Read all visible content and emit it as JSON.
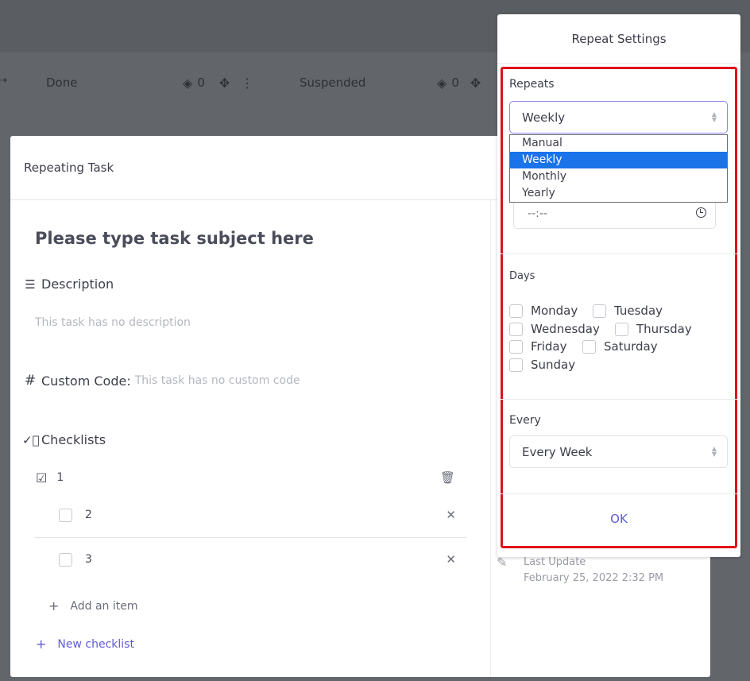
{
  "board": {
    "columns": [
      {
        "title": "Done",
        "count": "0"
      },
      {
        "title": "Suspended",
        "count": "0"
      }
    ]
  },
  "task_modal": {
    "header": "Repeating Task",
    "subject_placeholder": "Please type task subject here",
    "description_label": "Description",
    "description_empty": "This task has no description",
    "custom_code_label": "Custom Code:",
    "custom_code_empty": "This task has no custom code",
    "checklists_label": "Checklists",
    "checklist": {
      "title": "1",
      "items": [
        {
          "label": "2"
        },
        {
          "label": "3"
        }
      ],
      "add_item": "Add an item"
    },
    "new_checklist": "New checklist",
    "last_update_label": "Last Update",
    "last_update_value": "February 25, 2022 2:32 PM"
  },
  "repeat_settings": {
    "title": "Repeat Settings",
    "repeats_label": "Repeats",
    "repeats_value": "Weekly",
    "repeats_options": [
      "Manual",
      "Weekly",
      "Monthly",
      "Yearly"
    ],
    "time_value": "--:--",
    "days_label": "Days",
    "days": [
      "Monday",
      "Tuesday",
      "Wednesday",
      "Thursday",
      "Friday",
      "Saturday",
      "Sunday"
    ],
    "every_label": "Every",
    "every_value": "Every Week",
    "ok_label": "OK"
  },
  "colors": {
    "accent": "#5f5bd4",
    "highlight_outline": "#e0101a",
    "selected_option": "#1a73e8"
  }
}
